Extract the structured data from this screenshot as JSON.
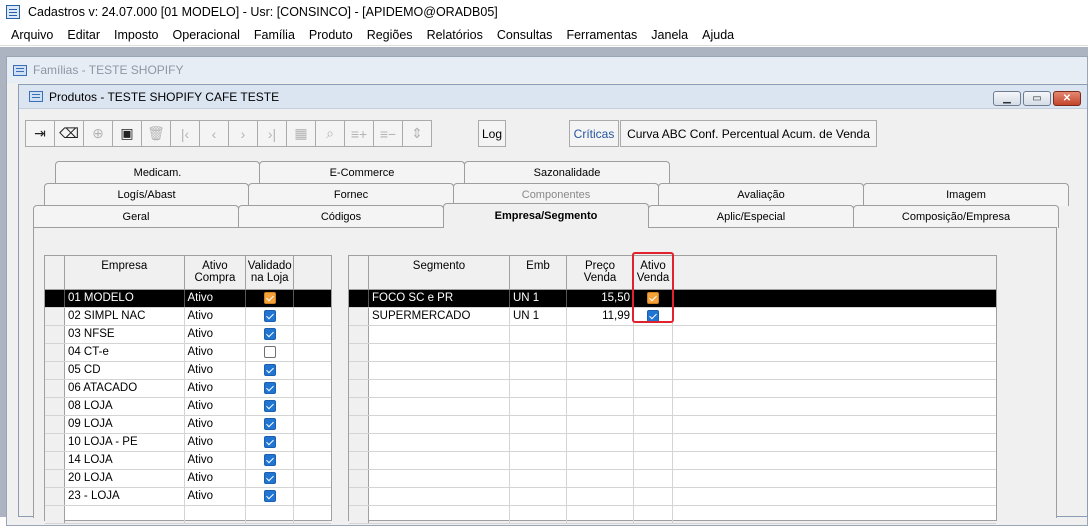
{
  "app": {
    "title": "Cadastros  v: 24.07.000  [01 MODELO] - Usr: [CONSINCO] - [APIDEMO@ORADB05]"
  },
  "menu": [
    "Arquivo",
    "Editar",
    "Imposto",
    "Operacional",
    "Família",
    "Produto",
    "Regiões",
    "Relatórios",
    "Consultas",
    "Ferramentas",
    "Janela",
    "Ajuda"
  ],
  "bg_window": {
    "title": "Famílias - TESTE SHOPIFY"
  },
  "window": {
    "title": "Produtos - TESTE SHOPIFY CAFE TESTE"
  },
  "toolbar": {
    "log_label": "Log",
    "criticas_label": "Críticas",
    "curva_label": "Curva ABC Conf. Percentual Acum. de Venda"
  },
  "tabs_row1": [
    "Medicam.",
    "E-Commerce",
    "Sazonalidade"
  ],
  "tabs_row2": [
    "Logís/Abast",
    "Fornec",
    "Componentes",
    "Avaliação",
    "Imagem"
  ],
  "tabs_row3": [
    "Geral",
    "Códigos",
    "Empresa/Segmento",
    "Aplic/Especial",
    "Composição/Empresa"
  ],
  "empresa_grid": {
    "headers": {
      "empresa": "Empresa",
      "ativo_compra": "Ativo\nCompra",
      "validado": "Validado\nna Loja"
    },
    "rows": [
      {
        "empresa": "01 MODELO",
        "ativo": "Ativo",
        "validado": true
      },
      {
        "empresa": "02 SIMPL NAC",
        "ativo": "Ativo",
        "validado": true
      },
      {
        "empresa": "03 NFSE",
        "ativo": "Ativo",
        "validado": true
      },
      {
        "empresa": "04 CT-e",
        "ativo": "Ativo",
        "validado": false
      },
      {
        "empresa": "05 CD",
        "ativo": "Ativo",
        "validado": true
      },
      {
        "empresa": "06 ATACADO",
        "ativo": "Ativo",
        "validado": true
      },
      {
        "empresa": "08 LOJA",
        "ativo": "Ativo",
        "validado": true
      },
      {
        "empresa": "09 LOJA",
        "ativo": "Ativo",
        "validado": true
      },
      {
        "empresa": "10 LOJA - PE",
        "ativo": "Ativo",
        "validado": true
      },
      {
        "empresa": "14 LOJA",
        "ativo": "Ativo",
        "validado": true
      },
      {
        "empresa": "20 LOJA",
        "ativo": "Ativo",
        "validado": true
      },
      {
        "empresa": "23 - LOJA",
        "ativo": "Ativo",
        "validado": true
      }
    ]
  },
  "segmento_grid": {
    "headers": {
      "segmento": "Segmento",
      "emb": "Emb",
      "preco": "Preço\nVenda",
      "ativo_venda": "Ativo\nVenda"
    },
    "rows": [
      {
        "segmento": "FOCO SC e PR",
        "emb": "UN  1",
        "preco": "15,50",
        "ativo": true
      },
      {
        "segmento": "SUPERMERCADO",
        "emb": "UN  1",
        "preco": "11,99",
        "ativo": true
      }
    ]
  }
}
